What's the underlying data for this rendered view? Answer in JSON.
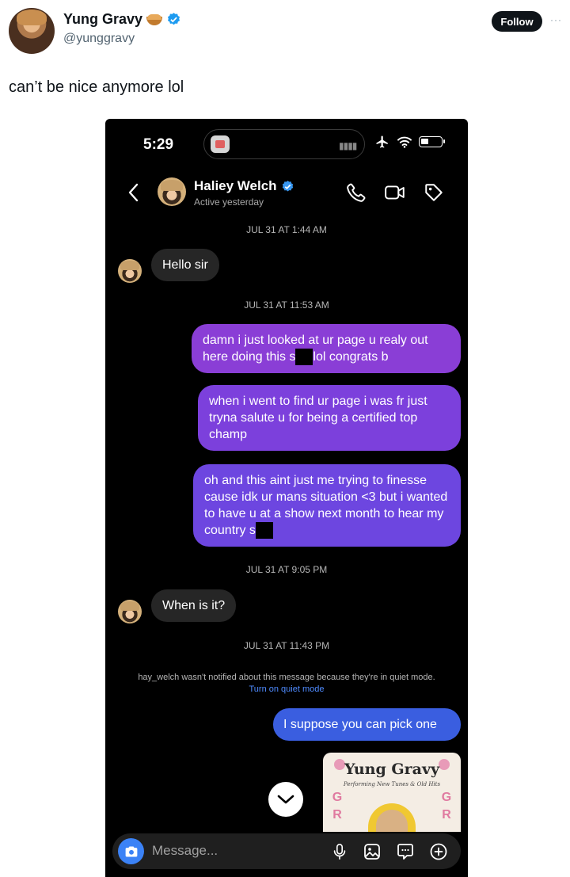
{
  "tweet": {
    "author_name": "Yung Gravy",
    "handle": "@yunggravy",
    "follow_label": "Follow",
    "more_label": "···",
    "text": "can’t be nice anymore lol"
  },
  "phone": {
    "status_time": "5:29",
    "header": {
      "name": "Haliey Welch",
      "status": "Active yesterday"
    },
    "messages": [
      {
        "type": "timestamp",
        "text": "JUL 31 AT 1:44 AM"
      },
      {
        "type": "received",
        "text": "Hello sir"
      },
      {
        "type": "timestamp",
        "text": "JUL 31 AT 11:53 AM"
      },
      {
        "type": "sent",
        "line1": "damn i just looked at ur page u realy out",
        "line2a": "here doing this s",
        "line2b": "lol congrats b"
      },
      {
        "type": "sent",
        "text": "when i went to find ur page i was fr just tryna salute u for being a certified  top champ"
      },
      {
        "type": "sent",
        "text1": "oh and this aint just me trying to finesse cause idk ur mans situation <3 but i wanted to have u at a show next month to hear my country s"
      },
      {
        "type": "timestamp",
        "text": "JUL 31 AT 9:05 PM"
      },
      {
        "type": "received",
        "text": "When is it?"
      },
      {
        "type": "timestamp",
        "text": "JUL 31 AT 11:43 PM"
      },
      {
        "type": "sent",
        "text": "I suppose you can pick one"
      }
    ],
    "quiet_notice": {
      "text": "hay_welch wasn't notified about this message because they're in quiet mode.",
      "link": "Turn on quiet mode"
    },
    "poster": {
      "title": "Yung Gravy",
      "subtitle": "Performing New Tunes & Old Hits",
      "side_letters": "G R"
    },
    "composer": {
      "placeholder": "Message..."
    }
  },
  "colors": {
    "verified": "#1d9bf0",
    "ig_verified": "#3897f0",
    "bubble_gradient": [
      "#8a3ed6",
      "#6d46e0",
      "#3a5ee0"
    ]
  }
}
